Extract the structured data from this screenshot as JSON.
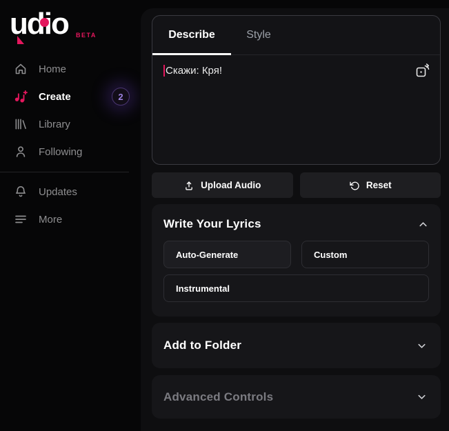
{
  "logo": {
    "wordmark": "udio",
    "beta": "BETA"
  },
  "sidebar": {
    "items": [
      {
        "label": "Home"
      },
      {
        "label": "Create",
        "badge": "2"
      },
      {
        "label": "Library"
      },
      {
        "label": "Following"
      }
    ],
    "secondary": [
      {
        "label": "Updates"
      },
      {
        "label": "More"
      }
    ]
  },
  "composer": {
    "tabs": [
      {
        "label": "Describe"
      },
      {
        "label": "Style"
      }
    ],
    "active_tab": "Describe",
    "prompt_text": "Скажи: Кря!"
  },
  "actions": {
    "upload_label": "Upload Audio",
    "reset_label": "Reset"
  },
  "lyrics": {
    "title": "Write Your Lyrics",
    "options": [
      {
        "label": "Auto-Generate"
      },
      {
        "label": "Custom"
      },
      {
        "label": "Instrumental"
      }
    ],
    "selected": "Auto-Generate"
  },
  "folder": {
    "title": "Add to Folder"
  },
  "advanced": {
    "title": "Advanced Controls"
  },
  "colors": {
    "accent_pink": "#e4175d",
    "badge_purple": "#9d82e0"
  }
}
